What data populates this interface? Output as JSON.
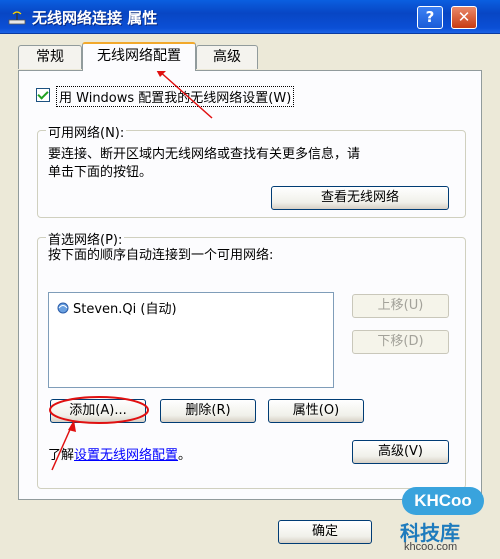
{
  "window": {
    "title": "无线网络连接 属性",
    "help_button": "?",
    "close_button": "✕"
  },
  "tabs": [
    {
      "label": "常规"
    },
    {
      "label": "无线网络配置",
      "active": true
    },
    {
      "label": "高级"
    }
  ],
  "use_windows_checkbox": {
    "label": "用 Windows 配置我的无线网络设置(W)",
    "checked": true
  },
  "available_networks": {
    "title": "可用网络(N):",
    "description_line1": "要连接、断开区域内无线网络或查找有关更多信息，请",
    "description_line2": "单击下面的按钮。",
    "view_button": "查看无线网络"
  },
  "preferred_networks": {
    "title": "首选网络(P):",
    "description": "按下面的顺序自动连接到一个可用网络:",
    "items": [
      {
        "name": "Steven.Qi",
        "status": "(自动)"
      }
    ],
    "move_up_button": "上移(U)",
    "move_down_button": "下移(D)",
    "add_button": "添加(A)...",
    "remove_button": "删除(R)",
    "properties_button": "属性(O)"
  },
  "learn_more": {
    "prefix": "了解",
    "link_text": "设置无线网络配置",
    "suffix": "。"
  },
  "advanced_button": "高级(V)",
  "ok_button": "确定",
  "watermark": {
    "logo": "KHCoo",
    "name": "科技库",
    "url": "khcoo.com"
  },
  "colors": {
    "titlebar": "#0a5fe0",
    "annotation_red": "#e01010",
    "link": "#0000ff"
  }
}
